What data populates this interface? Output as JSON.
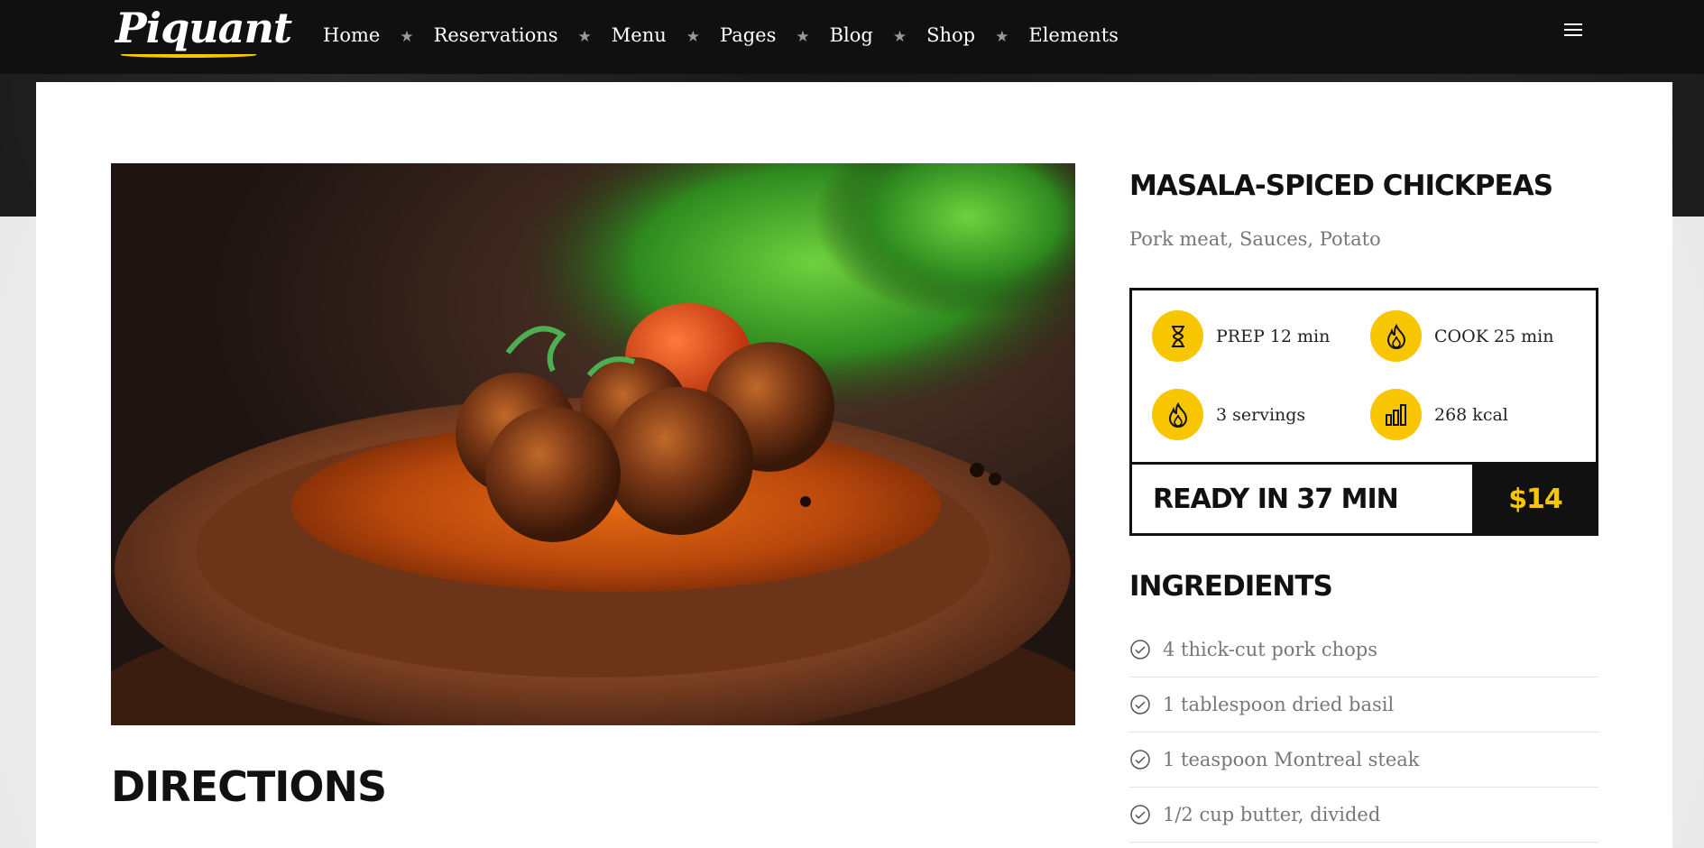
{
  "brand": {
    "logo_text": "Piquant",
    "accent": "#f7c600"
  },
  "nav": {
    "items": [
      "Home",
      "Reservations",
      "Menu",
      "Pages",
      "Blog",
      "Shop",
      "Elements"
    ],
    "separator_icon": "star-icon",
    "menu_icon": "hamburger-icon"
  },
  "recipe": {
    "title": "MASALA-SPICED CHICKPEAS",
    "subtitle": "Pork meat, Sauces, Potato",
    "image": "meatballs-in-sauce-photo",
    "stats": {
      "prep": {
        "icon": "hourglass-icon",
        "text": "PREP 12 min"
      },
      "cook": {
        "icon": "flame-icon",
        "text": "COOK 25 min"
      },
      "servings": {
        "icon": "flame-icon",
        "text": "3 servings"
      },
      "kcal": {
        "icon": "bar-chart-icon",
        "text": "268 kcal"
      }
    },
    "ready_label": "READY IN 37 MIN",
    "price": "$14"
  },
  "directions": {
    "title": "DIRECTIONS"
  },
  "ingredients": {
    "title": "INGREDIENTS",
    "items": [
      "4 thick-cut pork chops",
      "1 tablespoon dried basil",
      "1 teaspoon Montreal steak",
      "1/2 cup butter, divided"
    ]
  }
}
